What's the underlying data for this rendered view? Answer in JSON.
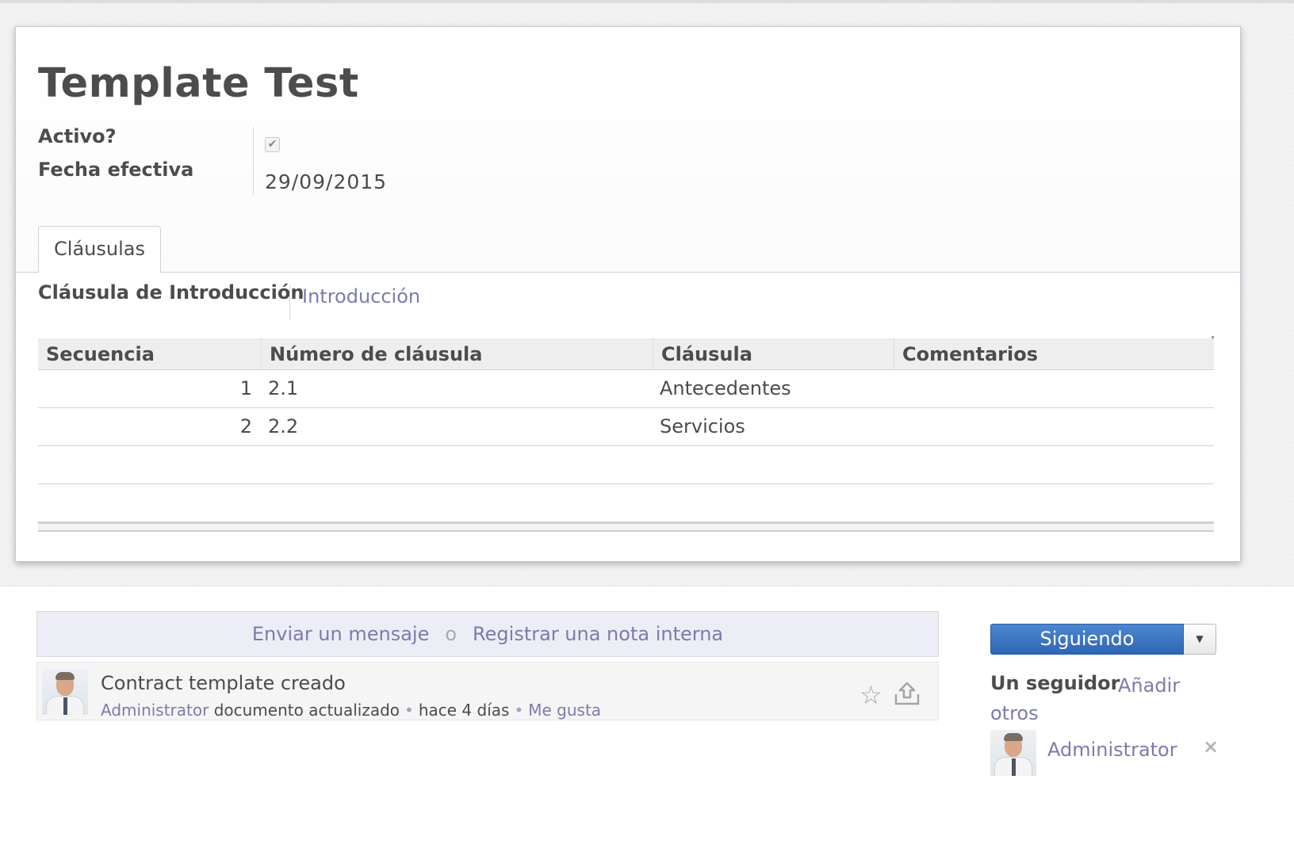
{
  "record": {
    "title": "Template Test",
    "fields": {
      "active_label": "Activo?",
      "active_checked": true,
      "effective_date_label": "Fecha efectiva",
      "effective_date_value": "29/09/2015"
    }
  },
  "tabs": [
    {
      "label": "Cláusulas",
      "active": true
    }
  ],
  "clauses_tab": {
    "intro_label": "Cláusula de Introducción",
    "intro_value": "Introducción",
    "table": {
      "columns": [
        "Secuencia",
        "Número de cláusula",
        "Cláusula",
        "Comentarios"
      ],
      "rows": [
        {
          "sequence": "1",
          "number": "2.1",
          "clause": "Antecedentes",
          "comments": ""
        },
        {
          "sequence": "2",
          "number": "2.2",
          "clause": "Servicios",
          "comments": ""
        }
      ]
    }
  },
  "chatter": {
    "composer": {
      "send_message": "Enviar un mensaje",
      "or": "o",
      "log_note": "Registrar una nota interna"
    },
    "messages": [
      {
        "title": "Contract template creado",
        "author": "Administrator",
        "action": "documento actualizado",
        "time": "hace 4 días",
        "like": "Me gusta"
      }
    ],
    "followers": {
      "button_label": "Siguiendo",
      "count_label": "Un seguidor",
      "add_label": "Añadir otros",
      "list": [
        {
          "name": "Administrator"
        }
      ],
      "remove_symbol": "×"
    }
  },
  "colors": {
    "link": "#7c7bad",
    "primary_button": "#3a74c2",
    "text": "#4c4c4c"
  },
  "icons": [
    "check-icon",
    "star-icon",
    "upload-icon",
    "caret-down-icon",
    "close-icon",
    "avatar"
  ]
}
